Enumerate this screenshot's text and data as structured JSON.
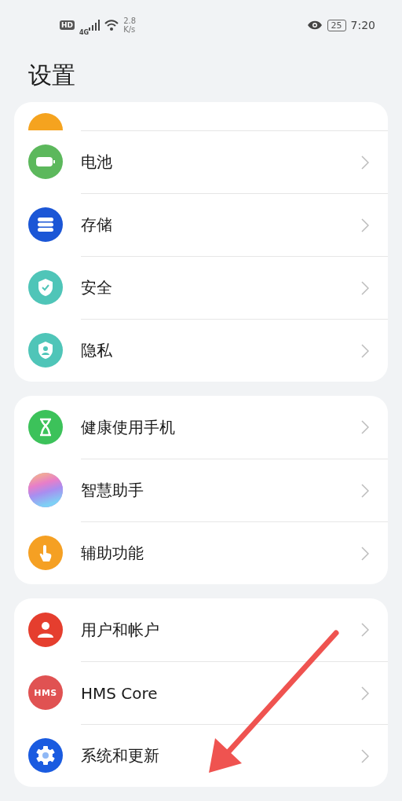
{
  "status_bar": {
    "hd": "HD",
    "network": "4G",
    "speed_value": "2.8",
    "speed_unit": "K/s",
    "battery": "25",
    "time": "7:20"
  },
  "title": "设置",
  "groups": [
    {
      "items": [
        {
          "kind": "apps",
          "label_hidden": true,
          "color": "#f5a31f"
        },
        {
          "kind": "battery",
          "label": "电池",
          "color": "#5cb85c"
        },
        {
          "kind": "storage",
          "label": "存储",
          "color": "#1b56d6"
        },
        {
          "kind": "security",
          "label": "安全",
          "color": "#4fc5b8"
        },
        {
          "kind": "privacy",
          "label": "隐私",
          "color": "#4fc5b8"
        }
      ]
    },
    {
      "items": [
        {
          "kind": "health",
          "label": "健康使用手机",
          "color": "#3cc25a"
        },
        {
          "kind": "assistant",
          "label": "智慧助手",
          "color": "#b58be8"
        },
        {
          "kind": "accessibility",
          "label": "辅助功能",
          "color": "#f5a023"
        }
      ]
    },
    {
      "items": [
        {
          "kind": "user",
          "label": "用户和帐户",
          "color": "#e53e2e"
        },
        {
          "kind": "hms",
          "label": "HMS Core",
          "badge": "HMS",
          "color": "#e05252"
        },
        {
          "kind": "system",
          "label": "系统和更新",
          "color": "#1a5be0"
        }
      ]
    }
  ]
}
